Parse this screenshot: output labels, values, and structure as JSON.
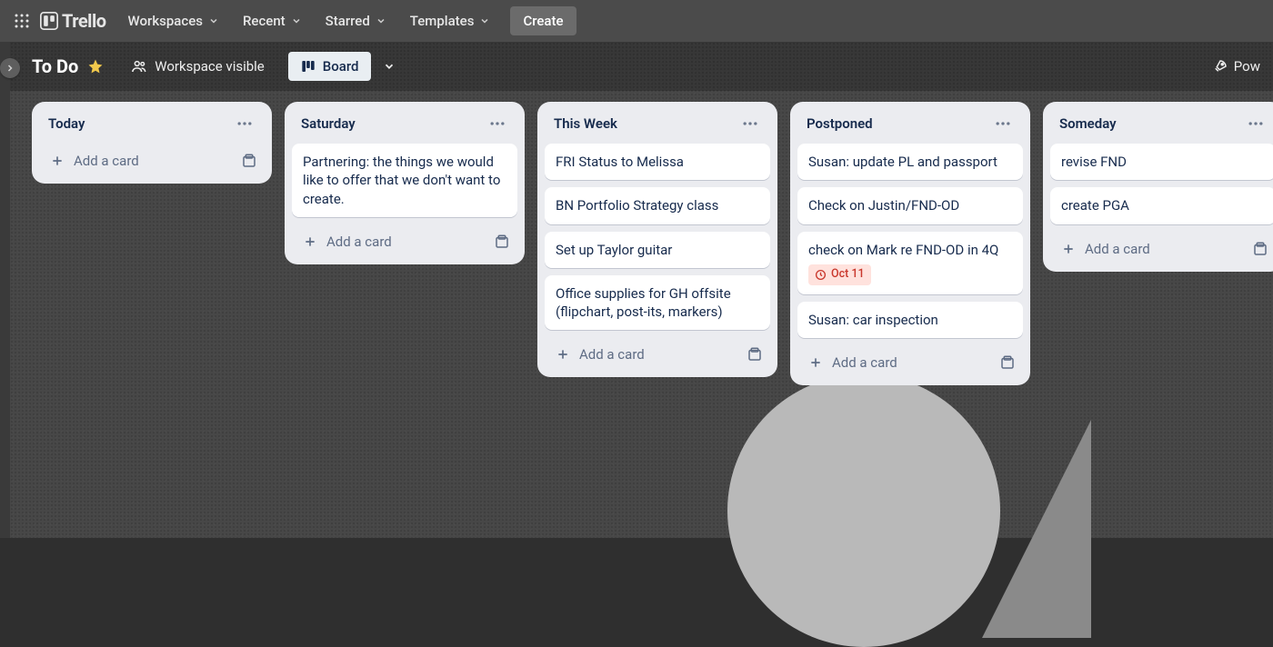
{
  "brand": "Trello",
  "nav": {
    "workspaces": "Workspaces",
    "recent": "Recent",
    "starred": "Starred",
    "templates": "Templates",
    "create": "Create"
  },
  "board_header": {
    "title": "To Do",
    "workspace_visible": "Workspace visible",
    "board_button": "Board",
    "power_ups": "Pow"
  },
  "add_card_label": "Add a card",
  "lists": [
    {
      "title": "Today",
      "cards": []
    },
    {
      "title": "Saturday",
      "cards": [
        {
          "text": "Partnering: the things we would like to offer that we don't want to create."
        }
      ]
    },
    {
      "title": "This Week",
      "cards": [
        {
          "text": "FRI Status to Melissa"
        },
        {
          "text": "BN Portfolio Strategy class"
        },
        {
          "text": "Set up Taylor guitar"
        },
        {
          "text": "Office supplies for GH offsite (flipchart, post-its, markers)"
        }
      ]
    },
    {
      "title": "Postponed",
      "cards": [
        {
          "text": "Susan: update PL and passport"
        },
        {
          "text": "Check on Justin/FND-OD"
        },
        {
          "text": "check on Mark re FND-OD in 4Q",
          "due": "Oct 11"
        },
        {
          "text": "Susan: car inspection"
        }
      ]
    },
    {
      "title": "Someday",
      "cards": [
        {
          "text": "revise FND"
        },
        {
          "text": "create PGA"
        }
      ]
    }
  ]
}
